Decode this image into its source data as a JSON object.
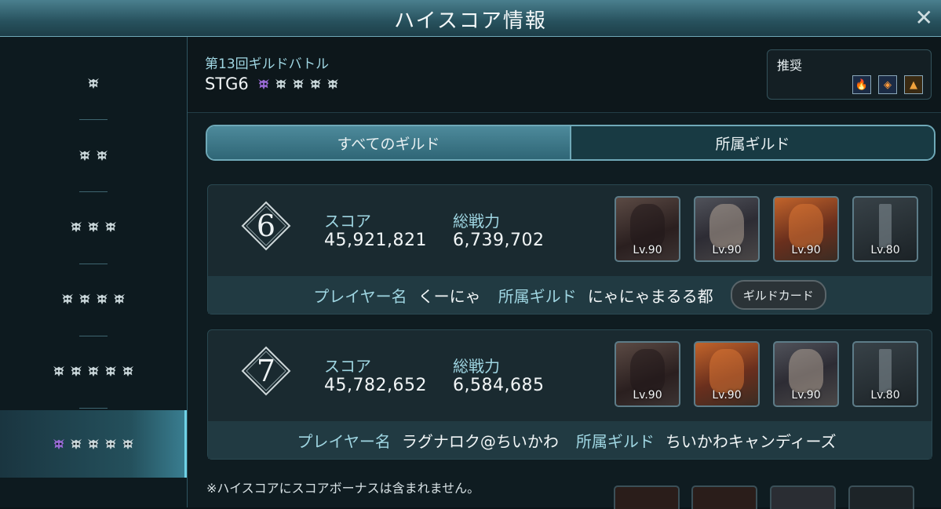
{
  "window": {
    "title": "ハイスコア情報"
  },
  "colors": {
    "accent": "#6fa9b8",
    "label": "#9fd6e2",
    "selected_skull": "#9b6bd6"
  },
  "sidebar": {
    "items": [
      {
        "count": 1,
        "active": false
      },
      {
        "count": 2,
        "active": false
      },
      {
        "count": 3,
        "active": false
      },
      {
        "count": 4,
        "active": false
      },
      {
        "count": 5,
        "active": false
      },
      {
        "count": 5,
        "active": true,
        "highlighted": 1
      }
    ]
  },
  "header": {
    "battle": "第13回ギルドバトル",
    "stage": "STG6",
    "recommend_label": "推奨",
    "recommend_icons": [
      "fire-icon",
      "diamond-element-icon",
      "triangle-element-icon"
    ]
  },
  "tabs": [
    {
      "label": "すべてのギルド",
      "active": true
    },
    {
      "label": "所属ギルド",
      "active": false
    }
  ],
  "labels": {
    "score": "スコア",
    "power": "総戦力",
    "player": "プレイヤー名",
    "guild": "所属ギルド",
    "guild_card": "ギルドカード"
  },
  "entries": [
    {
      "rank": "6",
      "score": "45,921,821",
      "power": "6,739,702",
      "player": "くーにゃ",
      "guild": "にゃにゃまるる都",
      "characters": [
        {
          "lv": "Lv.90",
          "icon": "dark-haired-warrior-portrait"
        },
        {
          "lv": "Lv.90",
          "icon": "young-man-portrait"
        },
        {
          "lv": "Lv.90",
          "icon": "red-beast-portrait"
        },
        {
          "lv": "Lv.80",
          "icon": "sword-portrait"
        }
      ]
    },
    {
      "rank": "7",
      "score": "45,782,652",
      "power": "6,584,685",
      "player": "ラグナロク@ちいかわ",
      "guild": "ちいかわキャンディーズ",
      "characters": [
        {
          "lv": "Lv.90",
          "icon": "dark-haired-warrior-portrait"
        },
        {
          "lv": "Lv.90",
          "icon": "red-beast-portrait"
        },
        {
          "lv": "Lv.90",
          "icon": "young-man-portrait"
        },
        {
          "lv": "Lv.80",
          "icon": "sword-portrait"
        }
      ]
    }
  ],
  "note": "※ハイスコアにスコアボーナスは含まれません。"
}
